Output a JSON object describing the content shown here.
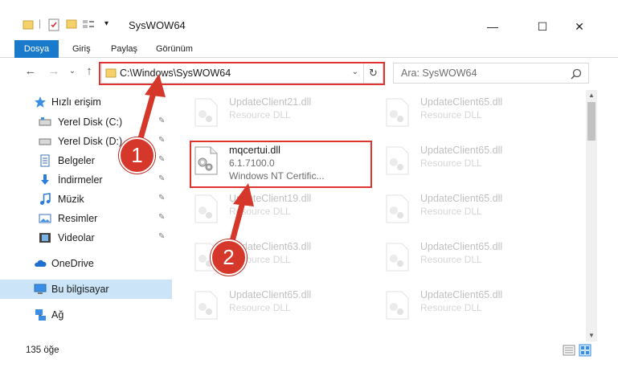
{
  "window": {
    "title": "SysWOW64",
    "minimize_glyph": "—",
    "maximize_glyph": "☐",
    "close_glyph": "✕"
  },
  "ribbon": {
    "tabs": [
      {
        "label": "Dosya",
        "active": true
      },
      {
        "label": "Giriş"
      },
      {
        "label": "Paylaş"
      },
      {
        "label": "Görünüm"
      }
    ]
  },
  "address_bar": {
    "path": "C:\\Windows\\SysWOW64",
    "refresh_glyph": "↻",
    "chevron_glyph": "⌄"
  },
  "search": {
    "placeholder": "Ara: SysWOW64"
  },
  "nav": {
    "back_glyph": "←",
    "forward_glyph": "→",
    "recent_glyph": "⌄",
    "up_glyph": "↑"
  },
  "sidebar": {
    "items": [
      {
        "label": "Hızlı erişim",
        "icon": "star-icon"
      },
      {
        "label": "Yerel Disk (C:)",
        "icon": "drive-icon",
        "pinned": true
      },
      {
        "label": "Yerel Disk (D:)",
        "icon": "drive-icon",
        "pinned": true
      },
      {
        "label": "Belgeler",
        "icon": "document-icon",
        "pinned": true
      },
      {
        "label": "İndirmeler",
        "icon": "download-icon",
        "pinned": true
      },
      {
        "label": "Müzik",
        "icon": "music-icon",
        "pinned": true
      },
      {
        "label": "Resimler",
        "icon": "picture-icon",
        "pinned": true
      },
      {
        "label": "Videolar",
        "icon": "video-icon",
        "pinned": true
      },
      {
        "label": "OneDrive",
        "icon": "cloud-icon"
      },
      {
        "label": "Bu bilgisayar",
        "icon": "computer-icon",
        "selected": true
      },
      {
        "label": "Ağ",
        "icon": "network-icon"
      }
    ],
    "pin_glyph": "📌"
  },
  "files": [
    {
      "name": "UpdateClient21.dll",
      "type": "Resource DLL",
      "faded": true
    },
    {
      "name": "UpdateClient65.dll",
      "type": "Resource DLL",
      "faded": true
    },
    {
      "name": "mqcertui.dll",
      "version": "6.1.7100.0",
      "type": "Windows NT Certific...",
      "faded": false
    },
    {
      "name": "UpdateClient65.dll",
      "type": "Resource DLL",
      "faded": true
    },
    {
      "name": "UpdateClient19.dll",
      "type": "Resource DLL",
      "faded": true
    },
    {
      "name": "UpdateClient65.dll",
      "type": "Resource DLL",
      "faded": true
    },
    {
      "name": "UpdateClient63.dll",
      "type": "Resource DLL",
      "faded": true
    },
    {
      "name": "UpdateClient65.dll",
      "type": "Resource DLL",
      "faded": true
    },
    {
      "name": "UpdateClient65.dll",
      "type": "Resource DLL",
      "faded": true
    },
    {
      "name": "UpdateClient65.dll",
      "type": "Resource DLL",
      "faded": true
    }
  ],
  "status": {
    "count": "135 öğe"
  },
  "annotations": {
    "step1": "1",
    "step2": "2",
    "color": "#d6372b"
  }
}
